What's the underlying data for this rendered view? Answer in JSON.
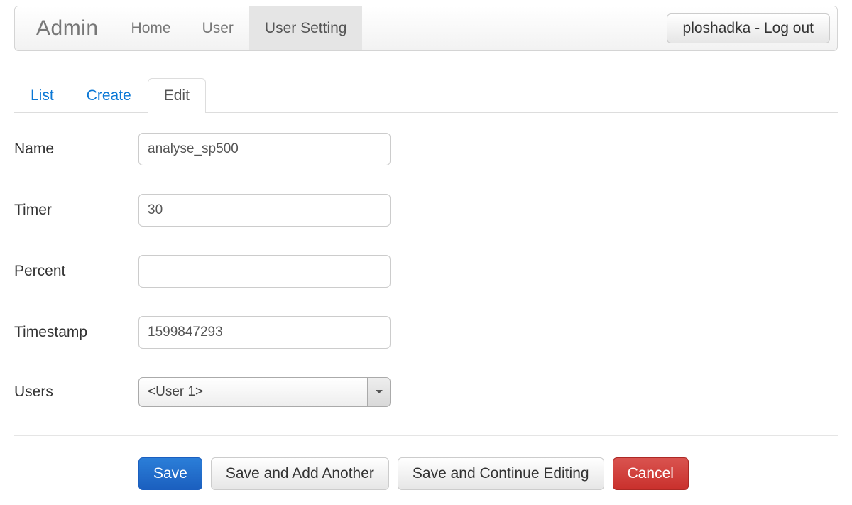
{
  "navbar": {
    "brand": "Admin",
    "items": [
      {
        "label": "Home",
        "active": false
      },
      {
        "label": "User",
        "active": false
      },
      {
        "label": "User Setting",
        "active": true
      }
    ],
    "logout_label": "ploshadka - Log out"
  },
  "tabs": [
    {
      "label": "List",
      "active": false
    },
    {
      "label": "Create",
      "active": false
    },
    {
      "label": "Edit",
      "active": true
    }
  ],
  "form": {
    "name": {
      "label": "Name",
      "value": "analyse_sp500"
    },
    "timer": {
      "label": "Timer",
      "value": "30"
    },
    "percent": {
      "label": "Percent",
      "value": ""
    },
    "timestamp": {
      "label": "Timestamp",
      "value": "1599847293"
    },
    "users": {
      "label": "Users",
      "selected": "<User 1>"
    }
  },
  "actions": {
    "save": "Save",
    "save_add": "Save and Add Another",
    "save_continue": "Save and Continue Editing",
    "cancel": "Cancel"
  }
}
